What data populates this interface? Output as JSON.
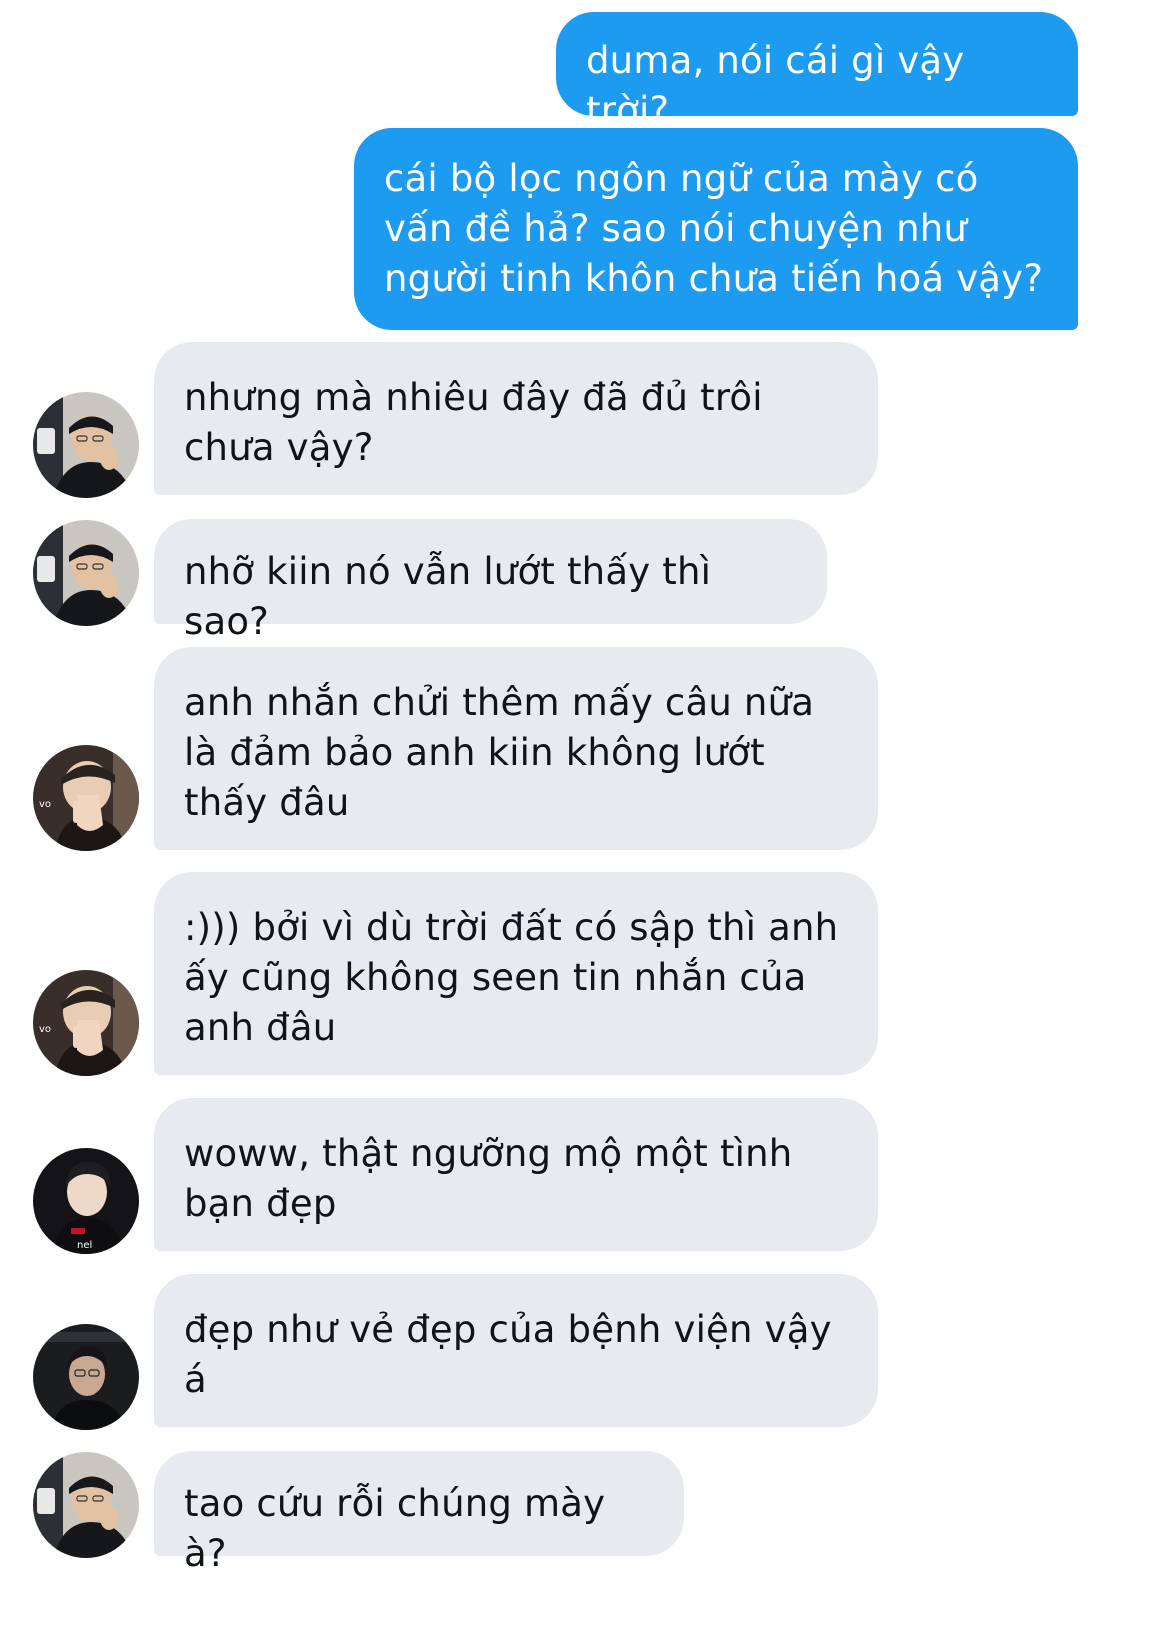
{
  "colors": {
    "outgoing_bubble": "#1d9bf0",
    "incoming_bubble": "#e7ebef",
    "outgoing_text": "#ffffff",
    "incoming_text": "#0f1419"
  },
  "messages": [
    {
      "direction": "outgoing",
      "text": "duma, nói cái gì vậy trời?"
    },
    {
      "direction": "outgoing",
      "text": "cái bộ lọc ngôn ngữ của mày có vấn đề hả? sao nói chuyện như người tinh khôn chưa tiến hoá vậy?"
    },
    {
      "direction": "incoming",
      "avatar": "avatar-user-a",
      "text": "nhưng mà nhiêu đây đã đủ trôi chưa vậy?"
    },
    {
      "direction": "incoming",
      "avatar": "avatar-user-a",
      "text": "nhỡ kiin nó vẫn lướt thấy thì sao?"
    },
    {
      "direction": "incoming",
      "avatar": "avatar-user-b",
      "text": "anh nhắn chửi thêm mấy câu nữa là đảm bảo anh kiin không lướt thấy đâu"
    },
    {
      "direction": "incoming",
      "avatar": "avatar-user-b",
      "text": ":))) bởi vì dù trời đất có sập thì anh ấy cũng không seen tin nhắn của anh đâu"
    },
    {
      "direction": "incoming",
      "avatar": "avatar-user-c",
      "text": "woww, thật ngưỡng mộ một tình bạn đẹp"
    },
    {
      "direction": "incoming",
      "avatar": "avatar-user-d",
      "text": "đẹp như vẻ đẹp của bệnh viện vậy á"
    },
    {
      "direction": "incoming",
      "avatar": "avatar-user-a",
      "text": "tao cứu rỗi chúng mày à?"
    }
  ]
}
